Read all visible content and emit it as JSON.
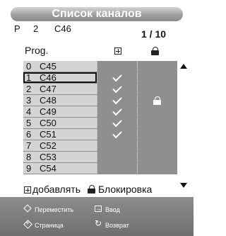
{
  "title": "Список каналов",
  "status": {
    "mode": "P",
    "number": "2",
    "channel": "C46"
  },
  "page_indicator": "1 / 10",
  "columns": {
    "prog": "Prog.",
    "add_icon": "plus-box-icon",
    "lock_icon": "lock-icon"
  },
  "rows": [
    {
      "num": "0",
      "name": "C45",
      "added": false,
      "locked": false,
      "selected": false
    },
    {
      "num": "1",
      "name": "C46",
      "added": true,
      "locked": false,
      "selected": true
    },
    {
      "num": "2",
      "name": "C47",
      "added": true,
      "locked": false,
      "selected": false
    },
    {
      "num": "3",
      "name": "C48",
      "added": true,
      "locked": true,
      "selected": false
    },
    {
      "num": "4",
      "name": "C49",
      "added": true,
      "locked": false,
      "selected": false
    },
    {
      "num": "5",
      "name": "C50",
      "added": true,
      "locked": false,
      "selected": false
    },
    {
      "num": "6",
      "name": "C51",
      "added": true,
      "locked": false,
      "selected": false
    },
    {
      "num": "7",
      "name": "C52",
      "added": false,
      "locked": false,
      "selected": false
    },
    {
      "num": "8",
      "name": "C53",
      "added": false,
      "locked": false,
      "selected": false
    },
    {
      "num": "9",
      "name": "C54",
      "added": false,
      "locked": false,
      "selected": false
    }
  ],
  "legend": {
    "add_label": "добавлять",
    "lock_label": "Блокировка"
  },
  "footer": {
    "move_label": "Переместить",
    "enter_label": "Ввод",
    "page_label": "Страница",
    "return_label": "Возврат"
  },
  "colors": {
    "panel_grey": "#8f8f8f",
    "name_cell": "#d4d4d4",
    "footer": "#7a7a7a"
  }
}
